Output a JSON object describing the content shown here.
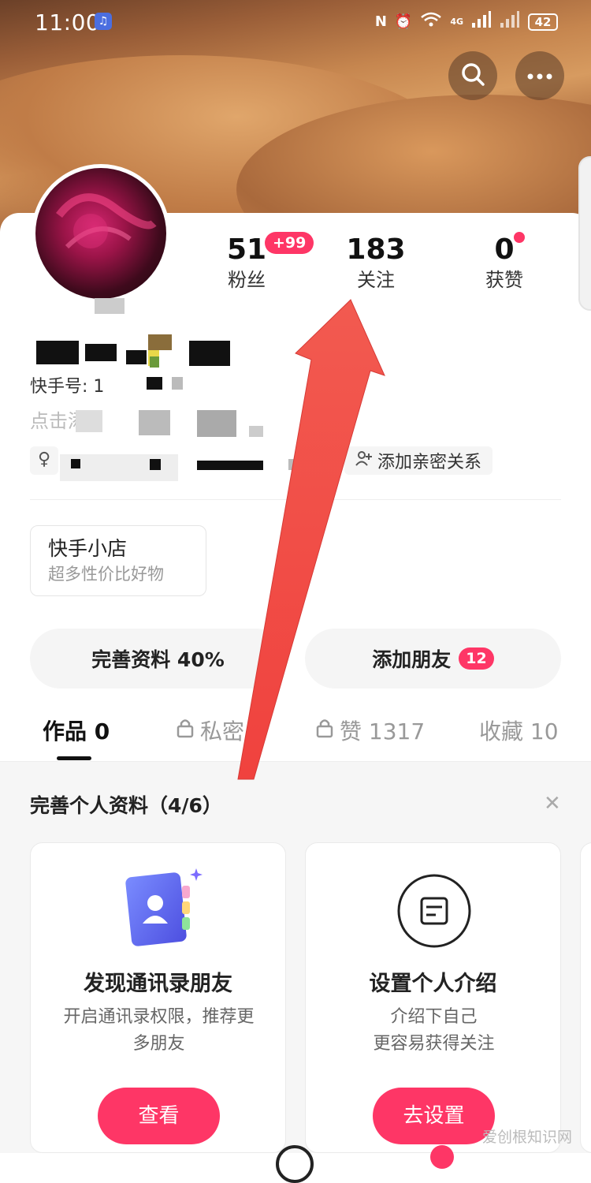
{
  "status_bar": {
    "time": "11:00",
    "signal_4g": "4G",
    "battery": "42"
  },
  "header": {
    "search_icon": "search-icon",
    "more_icon": "more-dots-icon"
  },
  "stats": [
    {
      "value": "51",
      "label": "粉丝",
      "badge": "+99"
    },
    {
      "value": "183",
      "label": "关注"
    },
    {
      "value": "0",
      "label": "获赞"
    }
  ],
  "profile": {
    "id_prefix": "快手号: 1",
    "bio_prefix": "点击添",
    "intimacy_button": "添加亲密关系"
  },
  "shop": {
    "title": "快手小店",
    "subtitle": "超多性价比好物"
  },
  "actions": {
    "complete_profile": "完善资料 40%",
    "add_friends": "添加朋友",
    "add_friends_badge": "12"
  },
  "tabs": [
    {
      "label": "作品 0"
    },
    {
      "label": "私密 8"
    },
    {
      "label": "赞 1317"
    },
    {
      "label": "收藏 10"
    }
  ],
  "completion": {
    "title": "完善个人资料（4/6）",
    "cards": [
      {
        "title": "发现通讯录朋友",
        "desc_line1": "开启通讯录权限，推荐更",
        "desc_line2": "多朋友",
        "button": "查看"
      },
      {
        "title": "设置个人介绍",
        "desc_line1": "介绍下自己",
        "desc_line2": "更容易获得关注",
        "button": "去设置"
      }
    ]
  },
  "watermark": "爱创根知识网",
  "colors": {
    "accent": "#fe3666",
    "annotation_arrow": "#f24a4a"
  }
}
